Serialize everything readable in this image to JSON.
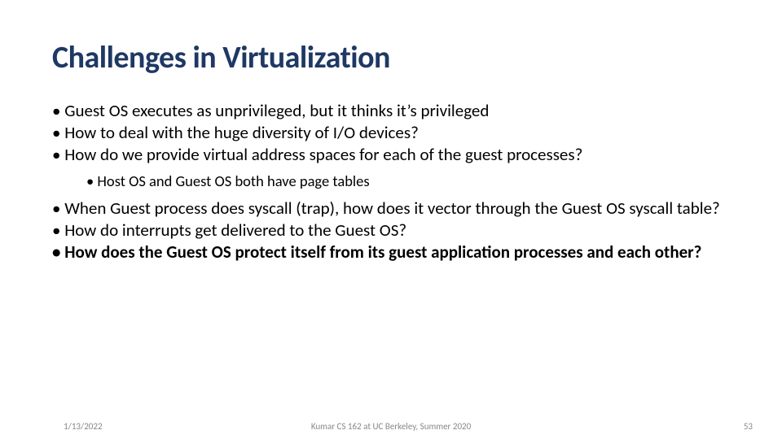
{
  "title": "Challenges in Virtualization",
  "bullets": {
    "b1": "Guest OS executes as unprivileged, but it thinks it’s privileged",
    "b2": "How to deal with the huge diversity of I/O devices?",
    "b3": "How do we provide virtual address spaces for each of the guest processes?",
    "b3a": "Host OS and Guest OS both have page tables",
    "b4": "When Guest process does syscall (trap), how does it vector through the Guest OS syscall table?",
    "b5": "How do interrupts get delivered to the Guest OS?",
    "b6": "How does the Guest OS protect itself from its guest application processes and each other?"
  },
  "footer": {
    "date": "1/13/2022",
    "mid": "Kumar CS 162 at UC Berkeley, Summer 2020",
    "num": "53"
  }
}
